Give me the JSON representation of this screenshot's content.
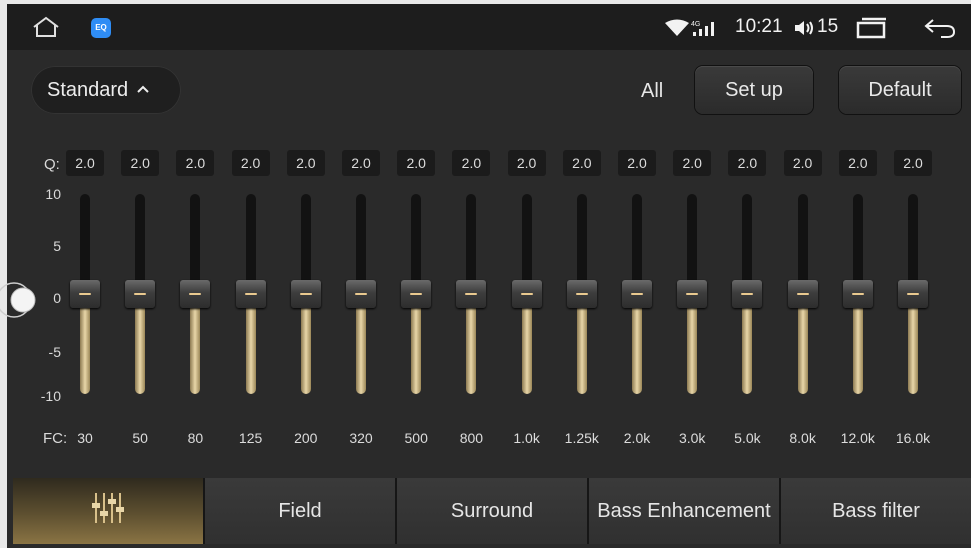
{
  "status_bar": {
    "time": "10:21",
    "volume": "15",
    "network": "4G",
    "icons": [
      "home-icon",
      "app-icon",
      "wifi-icon",
      "signal-icon",
      "volume-icon",
      "recent-apps-icon",
      "back-icon"
    ]
  },
  "header": {
    "preset_label": "Standard",
    "all_label": "All",
    "setup_label": "Set up",
    "default_label": "Default"
  },
  "equalizer": {
    "q_label": "Q:",
    "fc_label": "FC:",
    "scale": [
      "10",
      "5",
      "0",
      "-5",
      "-10"
    ],
    "bands": [
      {
        "fc": "30",
        "q": "2.0",
        "gain": 0
      },
      {
        "fc": "50",
        "q": "2.0",
        "gain": 0
      },
      {
        "fc": "80",
        "q": "2.0",
        "gain": 0
      },
      {
        "fc": "125",
        "q": "2.0",
        "gain": 0
      },
      {
        "fc": "200",
        "q": "2.0",
        "gain": 0
      },
      {
        "fc": "320",
        "q": "2.0",
        "gain": 0
      },
      {
        "fc": "500",
        "q": "2.0",
        "gain": 0
      },
      {
        "fc": "800",
        "q": "2.0",
        "gain": 0
      },
      {
        "fc": "1.0k",
        "q": "2.0",
        "gain": 0
      },
      {
        "fc": "1.25k",
        "q": "2.0",
        "gain": 0
      },
      {
        "fc": "2.0k",
        "q": "2.0",
        "gain": 0
      },
      {
        "fc": "3.0k",
        "q": "2.0",
        "gain": 0
      },
      {
        "fc": "5.0k",
        "q": "2.0",
        "gain": 0
      },
      {
        "fc": "8.0k",
        "q": "2.0",
        "gain": 0
      },
      {
        "fc": "12.0k",
        "q": "2.0",
        "gain": 0
      },
      {
        "fc": "16.0k",
        "q": "2.0",
        "gain": 0
      }
    ]
  },
  "tabs": [
    {
      "label": "",
      "icon": "equalizer-icon",
      "active": true
    },
    {
      "label": "Field",
      "active": false
    },
    {
      "label": "Surround",
      "active": false
    },
    {
      "label": "Bass Enhancement",
      "active": false
    },
    {
      "label": "Bass filter",
      "active": false
    }
  ],
  "colors": {
    "accent_gold": "#e8d6a8",
    "background": "#2a2a2a",
    "status_bar": "#1d1d1d"
  }
}
